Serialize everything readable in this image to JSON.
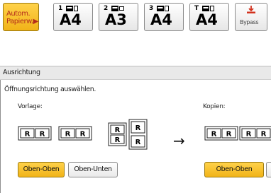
{
  "paper_trays": {
    "auto": {
      "label_line1": "Autom.",
      "label_line2": "Papierw.▶"
    },
    "trays": [
      {
        "number": "1",
        "size": "A4"
      },
      {
        "number": "2",
        "size": "A3"
      },
      {
        "number": "3",
        "size": "A4"
      },
      {
        "number": "T",
        "size": "A4"
      }
    ],
    "bypass": {
      "label": "Bypass"
    }
  },
  "section": {
    "title": "Ausrichtung"
  },
  "content": {
    "instruction": "Öffnungsrichtung auswählen.",
    "original_label": "Vorlage:",
    "copies_label": "Kopien:",
    "arrow": "→",
    "original_buttons": [
      {
        "label": "Oben-Oben",
        "selected": true
      },
      {
        "label": "Oben-Unten",
        "selected": false
      }
    ],
    "copies_button": {
      "label": "Oben-Oben",
      "selected": true
    },
    "page_glyph": "R"
  },
  "colors": {
    "selected": "#f5c12c",
    "auto_text": "#b42c1b",
    "bypass_icon": "#d2321e"
  }
}
